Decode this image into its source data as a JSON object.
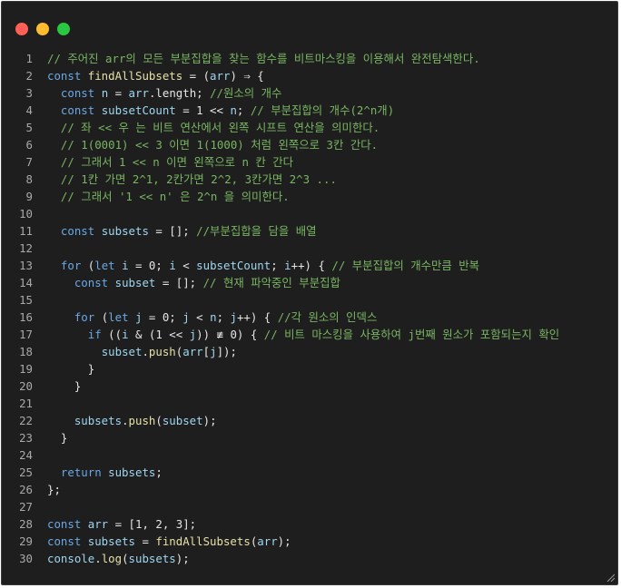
{
  "window": {
    "traffic_lights": [
      {
        "name": "close",
        "color": "#ff5f57"
      },
      {
        "name": "minimize",
        "color": "#febc2e"
      },
      {
        "name": "maximize",
        "color": "#28c840"
      }
    ]
  },
  "code_lines": [
    {
      "n": "1",
      "tokens": [
        {
          "t": "// 주어진 arr의 모든 부분집합을 찾는 함수를 비트마스킹을 이용해서 완전탐색한다.",
          "c": "c"
        }
      ]
    },
    {
      "n": "2",
      "tokens": [
        {
          "t": "const ",
          "c": "k"
        },
        {
          "t": "findAllSubsets",
          "c": "f"
        },
        {
          "t": " = (",
          "c": "n"
        },
        {
          "t": "arr",
          "c": "v"
        },
        {
          "t": ") ⇒ {",
          "c": "n"
        }
      ]
    },
    {
      "n": "3",
      "tokens": [
        {
          "t": "  const ",
          "c": "k"
        },
        {
          "t": "n",
          "c": "v"
        },
        {
          "t": " = ",
          "c": "n"
        },
        {
          "t": "arr",
          "c": "v"
        },
        {
          "t": ".length; ",
          "c": "n"
        },
        {
          "t": "//원소의 개수",
          "c": "c"
        }
      ]
    },
    {
      "n": "4",
      "tokens": [
        {
          "t": "  const ",
          "c": "k"
        },
        {
          "t": "subsetCount",
          "c": "v"
        },
        {
          "t": " = 1 << ",
          "c": "n"
        },
        {
          "t": "n",
          "c": "v"
        },
        {
          "t": "; ",
          "c": "n"
        },
        {
          "t": "// 부분집합의 개수(2^n개)",
          "c": "c"
        }
      ]
    },
    {
      "n": "5",
      "tokens": [
        {
          "t": "  // 좌 << 우 는 비트 연산에서 왼쪽 시프트 연산을 의미한다.",
          "c": "c"
        }
      ]
    },
    {
      "n": "6",
      "tokens": [
        {
          "t": "  // 1(0001) << 3 이면 1(1000) 처럼 왼쪽으로 3칸 간다.",
          "c": "c"
        }
      ]
    },
    {
      "n": "7",
      "tokens": [
        {
          "t": "  // 그래서 1 << n 이면 왼쪽으로 n 칸 간다",
          "c": "c"
        }
      ]
    },
    {
      "n": "8",
      "tokens": [
        {
          "t": "  // 1칸 가면 2^1, 2칸가면 2^2, 3칸가면 2^3 ...",
          "c": "c"
        }
      ]
    },
    {
      "n": "9",
      "tokens": [
        {
          "t": "  // 그래서 '1 << n' 은 2^n 을 의미한다.",
          "c": "c"
        }
      ]
    },
    {
      "n": "10",
      "tokens": []
    },
    {
      "n": "11",
      "tokens": [
        {
          "t": "  const ",
          "c": "k"
        },
        {
          "t": "subsets",
          "c": "v"
        },
        {
          "t": " = []; ",
          "c": "n"
        },
        {
          "t": "//부분집합을 담을 배열",
          "c": "c"
        }
      ]
    },
    {
      "n": "12",
      "tokens": []
    },
    {
      "n": "13",
      "tokens": [
        {
          "t": "  for ",
          "c": "k"
        },
        {
          "t": "(",
          "c": "n"
        },
        {
          "t": "let ",
          "c": "k"
        },
        {
          "t": "i",
          "c": "v"
        },
        {
          "t": " = 0; ",
          "c": "n"
        },
        {
          "t": "i",
          "c": "v"
        },
        {
          "t": " < ",
          "c": "n"
        },
        {
          "t": "subsetCount",
          "c": "v"
        },
        {
          "t": "; ",
          "c": "n"
        },
        {
          "t": "i",
          "c": "v"
        },
        {
          "t": "++) { ",
          "c": "n"
        },
        {
          "t": "// 부분집합의 개수만큼 반복",
          "c": "c"
        }
      ]
    },
    {
      "n": "14",
      "tokens": [
        {
          "t": "    const ",
          "c": "k"
        },
        {
          "t": "subset",
          "c": "v"
        },
        {
          "t": " = []; ",
          "c": "n"
        },
        {
          "t": "// 현재 파악중인 부분집합",
          "c": "c"
        }
      ]
    },
    {
      "n": "15",
      "tokens": []
    },
    {
      "n": "16",
      "tokens": [
        {
          "t": "    for ",
          "c": "k"
        },
        {
          "t": "(",
          "c": "n"
        },
        {
          "t": "let ",
          "c": "k"
        },
        {
          "t": "j",
          "c": "v"
        },
        {
          "t": " = 0; ",
          "c": "n"
        },
        {
          "t": "j",
          "c": "v"
        },
        {
          "t": " < ",
          "c": "n"
        },
        {
          "t": "n",
          "c": "v"
        },
        {
          "t": "; ",
          "c": "n"
        },
        {
          "t": "j",
          "c": "v"
        },
        {
          "t": "++) { ",
          "c": "n"
        },
        {
          "t": "//각 원소의 인덱스",
          "c": "c"
        }
      ]
    },
    {
      "n": "17",
      "tokens": [
        {
          "t": "      if ",
          "c": "k"
        },
        {
          "t": "((",
          "c": "n"
        },
        {
          "t": "i",
          "c": "v"
        },
        {
          "t": " & (1 << ",
          "c": "n"
        },
        {
          "t": "j",
          "c": "v"
        },
        {
          "t": ")) ≢ 0) { ",
          "c": "n"
        },
        {
          "t": "// 비트 마스킹을 사용하여 j번째 원소가 포함되는지 확인",
          "c": "c"
        }
      ]
    },
    {
      "n": "18",
      "tokens": [
        {
          "t": "        ",
          "c": "n"
        },
        {
          "t": "subset",
          "c": "v"
        },
        {
          "t": ".",
          "c": "n"
        },
        {
          "t": "push",
          "c": "f"
        },
        {
          "t": "(",
          "c": "n"
        },
        {
          "t": "arr",
          "c": "v"
        },
        {
          "t": "[",
          "c": "n"
        },
        {
          "t": "j",
          "c": "v"
        },
        {
          "t": "]);",
          "c": "n"
        }
      ]
    },
    {
      "n": "19",
      "tokens": [
        {
          "t": "      }",
          "c": "n"
        }
      ]
    },
    {
      "n": "20",
      "tokens": [
        {
          "t": "    }",
          "c": "n"
        }
      ]
    },
    {
      "n": "21",
      "tokens": []
    },
    {
      "n": "22",
      "tokens": [
        {
          "t": "    ",
          "c": "n"
        },
        {
          "t": "subsets",
          "c": "v"
        },
        {
          "t": ".",
          "c": "n"
        },
        {
          "t": "push",
          "c": "f"
        },
        {
          "t": "(",
          "c": "n"
        },
        {
          "t": "subset",
          "c": "v"
        },
        {
          "t": ");",
          "c": "n"
        }
      ]
    },
    {
      "n": "23",
      "tokens": [
        {
          "t": "  }",
          "c": "n"
        }
      ]
    },
    {
      "n": "24",
      "tokens": []
    },
    {
      "n": "25",
      "tokens": [
        {
          "t": "  return ",
          "c": "k"
        },
        {
          "t": "subsets",
          "c": "v"
        },
        {
          "t": ";",
          "c": "n"
        }
      ]
    },
    {
      "n": "26",
      "tokens": [
        {
          "t": "};",
          "c": "n"
        }
      ]
    },
    {
      "n": "27",
      "tokens": []
    },
    {
      "n": "28",
      "tokens": [
        {
          "t": "const ",
          "c": "k"
        },
        {
          "t": "arr",
          "c": "v"
        },
        {
          "t": " = [1, 2, 3];",
          "c": "n"
        }
      ]
    },
    {
      "n": "29",
      "tokens": [
        {
          "t": "const ",
          "c": "k"
        },
        {
          "t": "subsets",
          "c": "v"
        },
        {
          "t": " = ",
          "c": "n"
        },
        {
          "t": "findAllSubsets",
          "c": "f"
        },
        {
          "t": "(",
          "c": "n"
        },
        {
          "t": "arr",
          "c": "v"
        },
        {
          "t": ");",
          "c": "n"
        }
      ]
    },
    {
      "n": "30",
      "tokens": [
        {
          "t": "console",
          "c": "v"
        },
        {
          "t": ".",
          "c": "n"
        },
        {
          "t": "log",
          "c": "f"
        },
        {
          "t": "(",
          "c": "n"
        },
        {
          "t": "subsets",
          "c": "v"
        },
        {
          "t": ");",
          "c": "n"
        }
      ]
    }
  ]
}
